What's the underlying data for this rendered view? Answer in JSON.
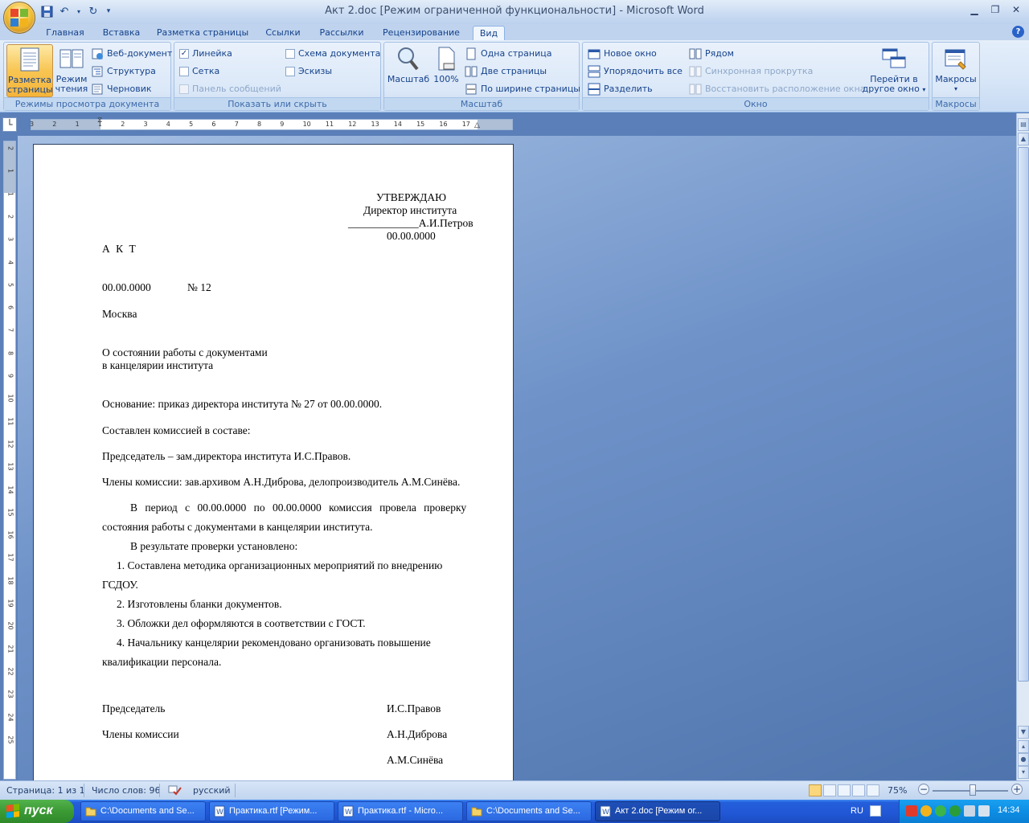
{
  "window": {
    "title": "Акт 2.doc [Режим ограниченной функциональности] - Microsoft Word"
  },
  "tabs": [
    "Главная",
    "Вставка",
    "Разметка страницы",
    "Ссылки",
    "Рассылки",
    "Рецензирование",
    "Вид"
  ],
  "active_tab": "Вид",
  "ribbon": {
    "views": {
      "label": "Режимы просмотра документа",
      "print_layout": [
        "Разметка",
        "страницы"
      ],
      "reading": [
        "Режим",
        "чтения"
      ],
      "web": "Веб-документ",
      "outline": "Структура",
      "draft": "Черновик"
    },
    "show": {
      "label": "Показать или скрыть",
      "ruler": "Линейка",
      "gridlines": "Сетка",
      "message_bar": "Панель сообщений",
      "doc_map": "Схема документа",
      "thumbnails": "Эскизы"
    },
    "zoom": {
      "label": "Масштаб",
      "zoom": "Масштаб",
      "hundred": "100%",
      "one_page": "Одна страница",
      "two_pages": "Две страницы",
      "page_width": "По ширине страницы"
    },
    "window": {
      "label": "Окно",
      "new_window": "Новое окно",
      "arrange_all": "Упорядочить все",
      "split": "Разделить",
      "side_by_side": "Рядом",
      "sync_scroll": "Синхронная прокрутка",
      "reset_pos": "Восстановить расположение окна",
      "switch": [
        "Перейти в",
        "другое окно"
      ]
    },
    "macros": {
      "label": "Макросы",
      "macros": "Макросы"
    }
  },
  "ruler": {
    "h_numbers": [
      "3",
      "2",
      "1",
      "1",
      "2",
      "3",
      "4",
      "5",
      "6",
      "7",
      "8",
      "9",
      "10",
      "11",
      "12",
      "13",
      "14",
      "15",
      "16",
      "17"
    ],
    "v_numbers": [
      "2",
      "1",
      "1",
      "2",
      "3",
      "4",
      "5",
      "6",
      "7",
      "8",
      "9",
      "10",
      "11",
      "12",
      "13",
      "14",
      "15",
      "16",
      "17",
      "18",
      "19",
      "20",
      "21",
      "22",
      "23",
      "24",
      "25"
    ]
  },
  "document": {
    "approve": "УТВЕРЖДАЮ",
    "director": "Директор института",
    "signature_line": "_____________А.И.Петров",
    "approve_date": "00.00.0000",
    "act": "А К Т",
    "date": "00.00.0000",
    "number": "№ 12",
    "city": "Москва",
    "subject1": "О состоянии работы с документами",
    "subject2": "в канцелярии института",
    "basis": "Основание: приказ директора института № 27 от 00.00.0000.",
    "composed": "Составлен комиссией в составе:",
    "chairman_line": "Председатель – зам.директора института И.С.Правов.",
    "members_line": "Члены комиссии: зав.архивом А.Н.Диброва, делопроизводитель А.М.Синёва.",
    "period1": "В период с 00.00.0000 по 00.00.0000 комиссия провела проверку",
    "period2": "состояния работы с документами в канцелярии института.",
    "result": "В результате проверки установлено:",
    "item1a": "1. Составлена методика организационных мероприятий по внедрению",
    "item1b": "ГСДОУ.",
    "item2": "2. Изготовлены бланки документов.",
    "item3": "3. Обложки дел оформляются в соответствии с ГОСТ.",
    "item4a": "4. Начальнику канцелярии рекомендовано организовать повышение",
    "item4b": "квалификации персонала.",
    "sig_chairman_label": "Председатель",
    "sig_chairman": "И.С.Правов",
    "sig_members_label": "Члены комиссии",
    "sig_member1": "А.Н.Диброва",
    "sig_member2": "А.М.Синёва"
  },
  "status": {
    "page": "Страница: 1 из 1",
    "words": "Число слов: 96",
    "language": "русский",
    "zoom": "75%",
    "zoom_level_percent": 75
  },
  "taskbar": {
    "start": "пуск",
    "tasks": [
      "C:\\Documents and Se...",
      "Практика.rtf [Режим...",
      "Практика.rtf - Micro...",
      "C:\\Documents and Se...",
      "Акт 2.doc [Режим ог..."
    ],
    "lang": "RU",
    "clock": "14:34"
  },
  "colors": {
    "ribbon_accent": "#15428b",
    "doc_background": "#5b7fb8",
    "taskbar": "#245edb",
    "start_button": "#3c9a35"
  }
}
